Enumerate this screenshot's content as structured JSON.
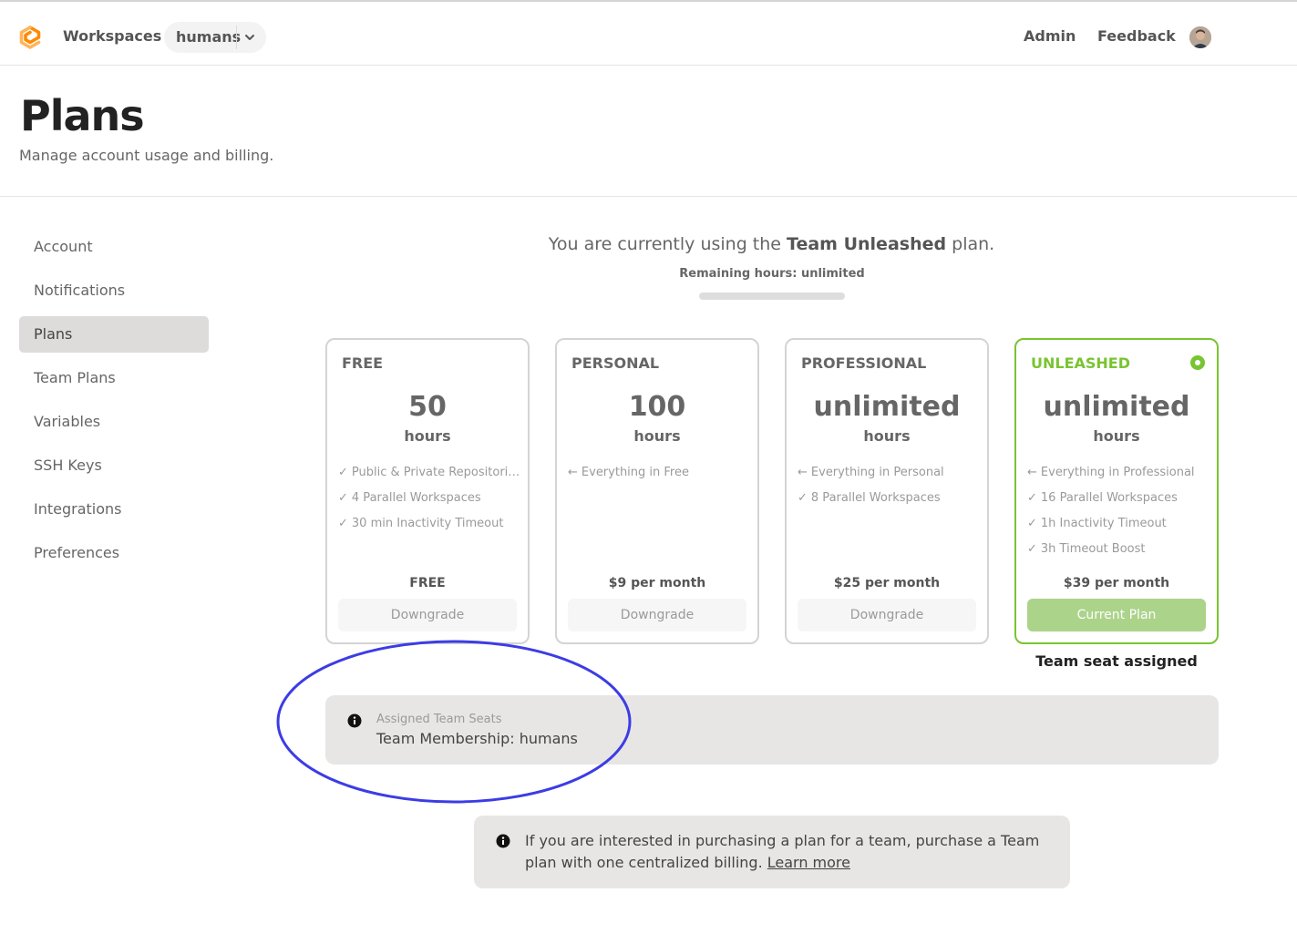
{
  "topbar": {
    "logo_icon": "gitpod-logo-icon",
    "workspaces_label": "Workspaces",
    "team_name": "humans",
    "team_chevron_icon": "chevron-down-icon",
    "admin_label": "Admin",
    "feedback_label": "Feedback",
    "avatar_icon": "user-avatar"
  },
  "header": {
    "title": "Plans",
    "subtitle": "Manage account usage and billing."
  },
  "sidebar": {
    "items": [
      {
        "label": "Account"
      },
      {
        "label": "Notifications"
      },
      {
        "label": "Plans"
      },
      {
        "label": "Team Plans"
      },
      {
        "label": "Variables"
      },
      {
        "label": "SSH Keys"
      },
      {
        "label": "Integrations"
      },
      {
        "label": "Preferences"
      }
    ],
    "active": "Plans"
  },
  "summary": {
    "prefix": "You are currently using the ",
    "plan_name": "Team Unleashed",
    "suffix": " plan.",
    "remaining": "Remaining hours: unlimited",
    "remaining_fraction": 1.0
  },
  "plans": [
    {
      "name": "FREE",
      "hours": "50",
      "unit": "hours",
      "features": [
        {
          "mark": "✓",
          "text": "Public & Private Repositories"
        },
        {
          "mark": "✓",
          "text": "4 Parallel Workspaces"
        },
        {
          "mark": "✓",
          "text": "30 min Inactivity Timeout"
        }
      ],
      "price": "FREE",
      "button": "Downgrade"
    },
    {
      "name": "PERSONAL",
      "hours": "100",
      "unit": "hours",
      "features": [
        {
          "mark": "←",
          "text": "Everything in Free"
        }
      ],
      "price": "$9 per month",
      "button": "Downgrade"
    },
    {
      "name": "PROFESSIONAL",
      "hours": "unlimited",
      "unit": "hours",
      "features": [
        {
          "mark": "←",
          "text": "Everything in Personal"
        },
        {
          "mark": "✓",
          "text": "8 Parallel Workspaces"
        }
      ],
      "price": "$25 per month",
      "button": "Downgrade"
    },
    {
      "name": "UNLEASHED",
      "hours": "unlimited",
      "unit": "hours",
      "features": [
        {
          "mark": "←",
          "text": "Everything in Professional"
        },
        {
          "mark": "✓",
          "text": "16 Parallel Workspaces"
        },
        {
          "mark": "✓",
          "text": "1h Inactivity Timeout"
        },
        {
          "mark": "✓",
          "text": "3h Timeout Boost"
        }
      ],
      "price": "$39 per month",
      "button": "Current Plan",
      "current": true,
      "check_icon": "selected-radio-icon"
    }
  ],
  "team_seat_note": "Team seat assigned",
  "seats_notice": {
    "icon": "info-icon",
    "label": "Assigned Team Seats",
    "value": "Team Membership: humans"
  },
  "team_notice": {
    "icon": "info-icon",
    "text": "If you are interested in purchasing a plan for a team, purchase a Team plan with one centralized billing. ",
    "link": "Learn more"
  },
  "colors": {
    "accent_green": "#79c431",
    "current_button": "#acd38a",
    "annotation_ellipse": "#3c3ce6",
    "logo_orange": "#ff8a00"
  }
}
